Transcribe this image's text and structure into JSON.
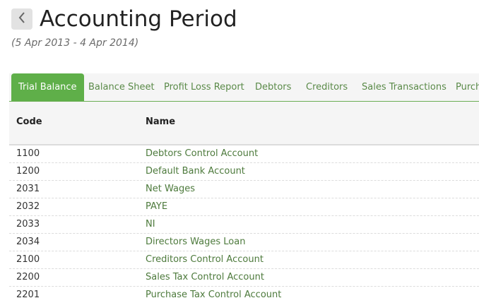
{
  "header": {
    "title": "Accounting Period",
    "period_range": "(5 Apr 2013 - 4 Apr 2014)",
    "back_icon": "chevron-left-icon"
  },
  "tabs": [
    {
      "label": "Trial Balance",
      "active": true
    },
    {
      "label": "Balance Sheet",
      "active": false
    },
    {
      "label": "Profit Loss Report",
      "active": false
    },
    {
      "label": "Debtors",
      "active": false
    },
    {
      "label": "Creditors",
      "active": false
    },
    {
      "label": "Sales Transactions",
      "active": false
    },
    {
      "label": "Purchases",
      "active": false
    }
  ],
  "table": {
    "columns": {
      "code": "Code",
      "name": "Name"
    },
    "rows": [
      {
        "code": "1100",
        "name": "Debtors Control Account"
      },
      {
        "code": "1200",
        "name": "Default Bank Account"
      },
      {
        "code": "2031",
        "name": "Net Wages"
      },
      {
        "code": "2032",
        "name": "PAYE"
      },
      {
        "code": "2033",
        "name": "NI"
      },
      {
        "code": "2034",
        "name": "Directors Wages Loan"
      },
      {
        "code": "2100",
        "name": "Creditors Control Account"
      },
      {
        "code": "2200",
        "name": "Sales Tax Control Account"
      },
      {
        "code": "2201",
        "name": "Purchase Tax Control Account"
      }
    ]
  },
  "colors": {
    "accent": "#5faf49",
    "link": "#4d7a3c"
  }
}
